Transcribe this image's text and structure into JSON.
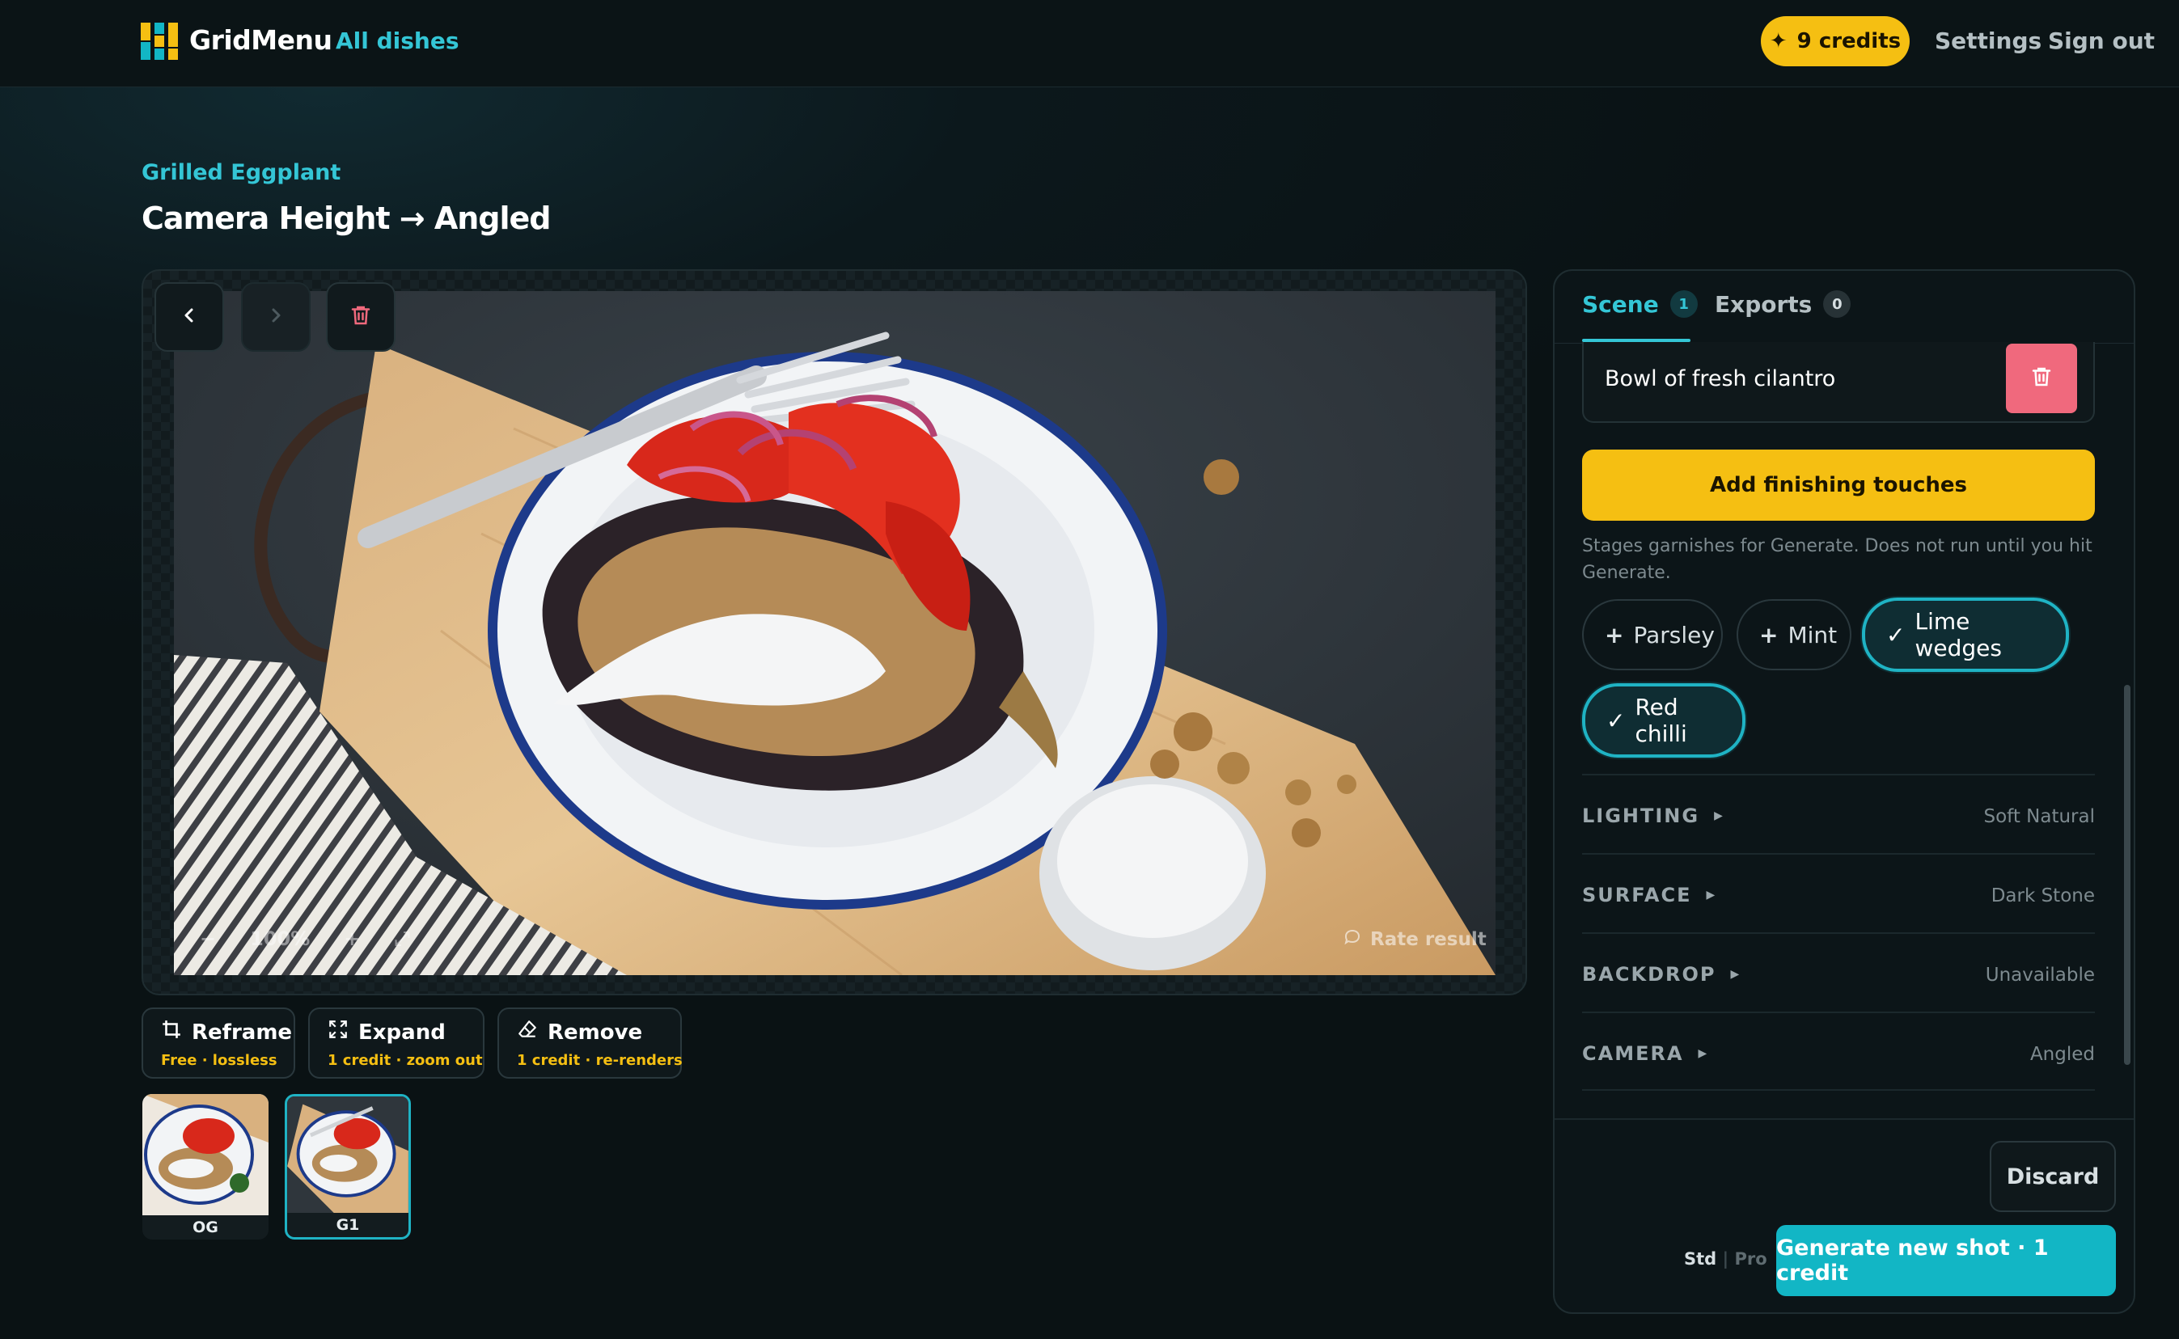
{
  "header": {
    "app_name": "GridMenu",
    "nav_all": "All dishes",
    "credits": "9 credits",
    "credits_icon": "sparkle-icon",
    "settings": "Settings",
    "sign_out": "Sign out"
  },
  "page": {
    "breadcrumb": "Grilled Eggplant",
    "title": "Camera Height → Angled"
  },
  "viewer": {
    "zoom": "100%",
    "rate_result": "Rate result"
  },
  "actions": [
    {
      "label": "Reframe",
      "sub": "Free · lossless",
      "icon": "crop-icon"
    },
    {
      "label": "Expand",
      "sub": "1 credit · zoom out",
      "icon": "expand-icon"
    },
    {
      "label": "Remove",
      "sub": "1 credit · re-renders",
      "icon": "eraser-icon"
    }
  ],
  "thumbnails": [
    {
      "label": "OG",
      "selected": false
    },
    {
      "label": "G1",
      "selected": true
    }
  ],
  "panel": {
    "tabs": [
      {
        "label": "Scene",
        "count": "1",
        "active": true
      },
      {
        "label": "Exports",
        "count": "0",
        "active": false
      }
    ],
    "scene_item": "Bowl of fresh cilantro",
    "finish_button": "Add finishing touches",
    "help_text": "Stages garnishes for Generate. Does not run until you hit Generate.",
    "garnishes": [
      {
        "label": "Parsley",
        "selected": false
      },
      {
        "label": "Mint",
        "selected": false
      },
      {
        "label": "Lime wedges",
        "selected": true
      },
      {
        "label": "Red chilli",
        "selected": true
      }
    ],
    "sections": [
      {
        "name": "LIGHTING",
        "value": "Soft Natural"
      },
      {
        "name": "SURFACE",
        "value": "Dark Stone"
      },
      {
        "name": "BACKDROP",
        "value": "Unavailable"
      },
      {
        "name": "CAMERA",
        "value": "Angled"
      }
    ],
    "discard": "Discard",
    "mode_std": "Std",
    "mode_sep": "|",
    "mode_pro": "Pro",
    "generate": "Generate new shot · 1 credit"
  },
  "colors": {
    "accent": "#34c6d6",
    "credits_yellow": "#f5bf12",
    "danger": "#f0697d",
    "generate": "#12b6c5"
  }
}
